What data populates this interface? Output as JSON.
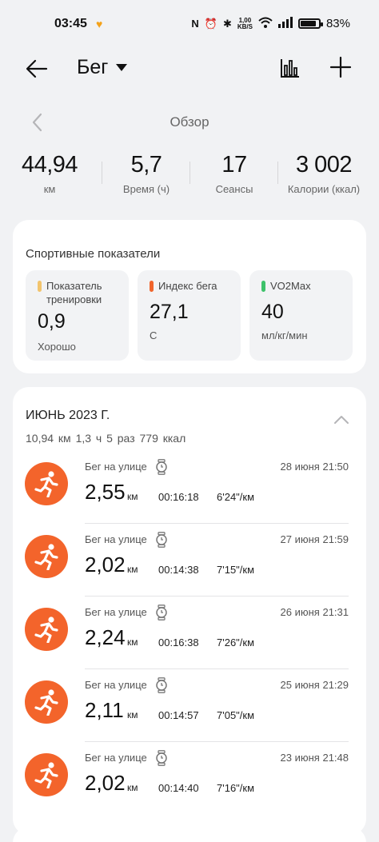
{
  "status_bar": {
    "time": "03:45",
    "net_speed_top": "1,00",
    "net_speed_bottom": "KB/S",
    "battery": "83%"
  },
  "header": {
    "title": "Бег",
    "icons": [
      "back-arrow-icon",
      "chevron-down-icon",
      "bar-chart-icon",
      "plus-icon"
    ]
  },
  "overview": {
    "title": "Обзор",
    "stats": [
      {
        "value": "44,94",
        "label": "км"
      },
      {
        "value": "5,7",
        "label": "Время (ч)"
      },
      {
        "value": "17",
        "label": "Сеансы"
      },
      {
        "value": "3 002",
        "label": "Калории (ккал)"
      }
    ]
  },
  "sport_metrics": {
    "title": "Спортивные показатели",
    "items": [
      {
        "label": "Показатель тренировки",
        "value": "0,9",
        "sub": "Хорошо",
        "color": "#f2c46d"
      },
      {
        "label": "Индекс бега",
        "value": "27,1",
        "sub": "С",
        "color": "#f0642c"
      },
      {
        "label": "VO2Max",
        "value": "40",
        "sub": "мл/кг/мин",
        "color": "#3ec26b"
      }
    ]
  },
  "month": {
    "title": "ИЮНЬ 2023 Г.",
    "summary": "10,94 км   1,3 ч   5 раз   779 ккал",
    "activities": [
      {
        "type": "Бег на улице",
        "date": "28 июня 21:50",
        "distance": "2,55",
        "unit": "км",
        "duration": "00:16:18",
        "pace": "6'24\"/км"
      },
      {
        "type": "Бег на улице",
        "date": "27 июня 21:59",
        "distance": "2,02",
        "unit": "км",
        "duration": "00:14:38",
        "pace": "7'15\"/км"
      },
      {
        "type": "Бег на улице",
        "date": "26 июня 21:31",
        "distance": "2,24",
        "unit": "км",
        "duration": "00:16:38",
        "pace": "7'26\"/км"
      },
      {
        "type": "Бег на улице",
        "date": "25 июня 21:29",
        "distance": "2,11",
        "unit": "км",
        "duration": "00:14:57",
        "pace": "7'05\"/км"
      },
      {
        "type": "Бег на улице",
        "date": "23 июня 21:48",
        "distance": "2,02",
        "unit": "км",
        "duration": "00:14:40",
        "pace": "7'16\"/км"
      }
    ]
  },
  "colors": {
    "accent": "#f3642b",
    "background": "#f1f2f4",
    "card": "#ffffff"
  }
}
